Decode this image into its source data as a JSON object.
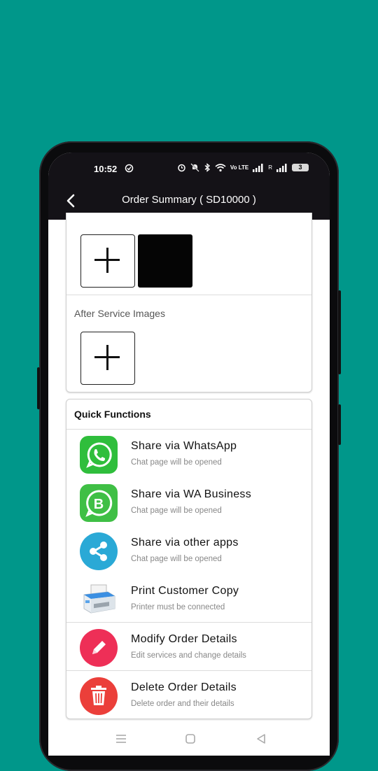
{
  "status_bar": {
    "time": "10:52",
    "network": "Vo LTE",
    "sim2": "R",
    "battery": "3"
  },
  "app_bar": {
    "title": "Order Summary ( SD10000 )"
  },
  "images_card": {
    "after_label": "After Service Images"
  },
  "quick_functions": {
    "title": "Quick Functions",
    "items": [
      {
        "label": "Share via WhatsApp",
        "subtitle": "Chat page will be opened",
        "icon": "whatsapp-icon",
        "color": "#2fbe3c"
      },
      {
        "label": "Share via WA Business",
        "subtitle": "Chat page will be opened",
        "icon": "wa-business-icon",
        "color": "#3fbf45"
      },
      {
        "label": "Share via other apps",
        "subtitle": "Chat page will be opened",
        "icon": "share-icon",
        "color": "#2aa9d6"
      },
      {
        "label": "Print Customer Copy",
        "subtitle": "Printer must be connected",
        "icon": "printer-icon",
        "color": "#4a9be0"
      },
      {
        "label": "Modify Order Details",
        "subtitle": "Edit services and change details",
        "icon": "pencil-icon",
        "color": "#ee2f57"
      },
      {
        "label": "Delete Order Details",
        "subtitle": "Delete order and their details",
        "icon": "trash-icon",
        "color": "#eb3f3a"
      }
    ]
  }
}
